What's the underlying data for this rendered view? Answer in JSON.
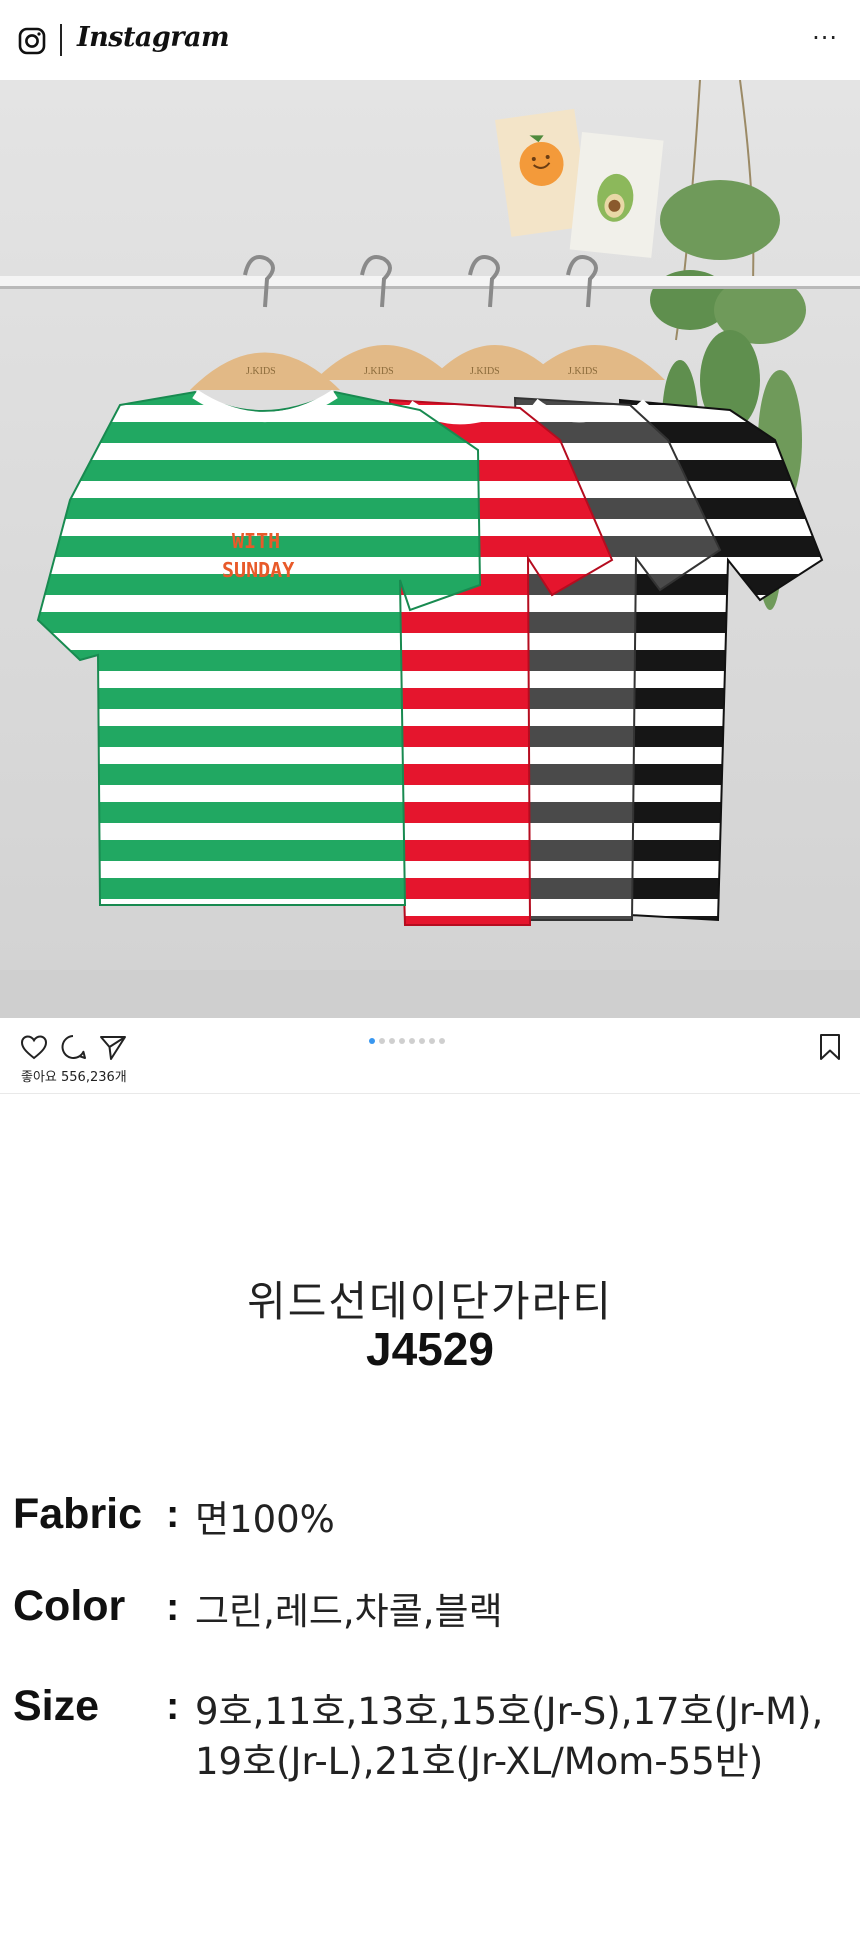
{
  "header": {
    "app_name": "Instagram",
    "more_label": "···"
  },
  "post": {
    "carousel_total": 8,
    "carousel_active": 1,
    "likes_text": "좋아요 556,236개",
    "image_labels": {
      "brand_tag": "J.KIDS",
      "shirt_print_line1": "WITH",
      "shirt_print_line2": "SUNDAY"
    },
    "shirt_colors": {
      "green": "#21a862",
      "red": "#e5152d",
      "charcoal": "#4a4a4a",
      "black": "#161616"
    }
  },
  "product": {
    "name": "위드선데이단가라티",
    "code": "J4529"
  },
  "specs": {
    "fabric_label": "Fabric",
    "fabric_value": "면100%",
    "color_label": "Color",
    "color_value": "그린,레드,차콜,블랙",
    "size_label": "Size",
    "size_value_line1": "9호,11호,13호,15호(Jr-S),17호(Jr-M),",
    "size_value_line2": "19호(Jr-L),21호(Jr-XL/Mom-55반)",
    "colon": ":"
  },
  "icons": {
    "instagram": "instagram-logo-icon",
    "more": "more-options-icon",
    "like": "heart-icon",
    "comment": "comment-icon",
    "share": "paper-plane-icon",
    "save": "bookmark-icon"
  }
}
